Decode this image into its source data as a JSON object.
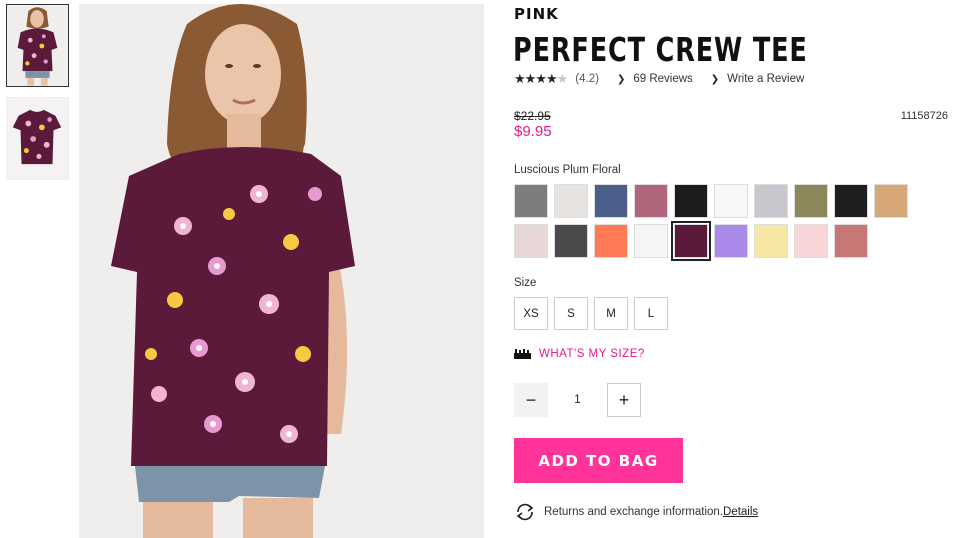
{
  "gallery": {
    "thumbnails": [
      {
        "icon": "model-photo-thumbnail"
      },
      {
        "icon": "flat-tee-thumbnail"
      }
    ],
    "main_image_icon": "model-wearing-floral-tee"
  },
  "product": {
    "brand": "PINK",
    "title": "PERFECT CREW TEE",
    "rating": {
      "stars": 4.2,
      "value_text": "(4.2)",
      "reviews_link": "69 Reviews",
      "write_review_link": "Write a Review"
    },
    "old_price": "$22.95",
    "price": "$9.95",
    "sku": "11158726",
    "selected_color": "Luscious Plum Floral",
    "swatch_colors": [
      "#7d7d7b",
      "#e6e3e0",
      "#4b5f8a",
      "#b0677b",
      "#1c1c1c",
      "#f7f7f7",
      "#c9c6cd",
      "#8b8758",
      "#1e1e1e",
      "#d7a877",
      "#e8d7d7",
      "#4a4a4d",
      "#ff7a55",
      "#f5f5f7",
      "#5c1a3a",
      "#a98ae8",
      "#f6e7a5",
      "#f9d5d8",
      "#c77876"
    ],
    "selected_swatch_index": 14,
    "size_label": "Size",
    "sizes": [
      "XS",
      "S",
      "M",
      "L"
    ],
    "size_guide_link": "WHAT'S MY SIZE?",
    "quantity": "1",
    "add_to_bag": "ADD TO BAG",
    "returns_text": "Returns and exchange information.",
    "returns_link": "Details"
  },
  "colors": {
    "accent_pink": "#e61a8d",
    "button_pink": "#ff3399",
    "tee_plum": "#5c1a3a"
  }
}
